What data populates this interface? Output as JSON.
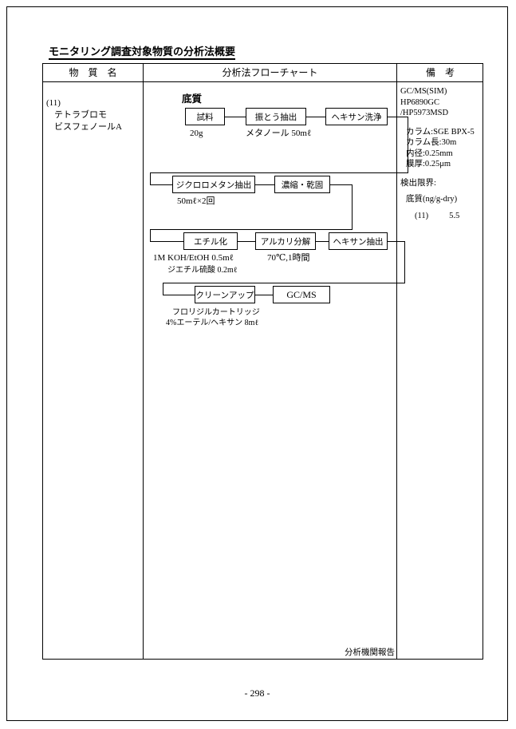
{
  "document": {
    "title": "モニタリング調査対象物質の分析法概要",
    "page_number": "- 298 -"
  },
  "table": {
    "headers": {
      "substance": "物　質　名",
      "flowchart": "分析法フローチャート",
      "remarks": "備　考"
    },
    "substance": {
      "number": "(11)",
      "name_line1": "テトラブロモ",
      "name_line2": "ビスフェノールA"
    },
    "remarks": {
      "instrument_line1": "GC/MS(SIM)",
      "instrument_line2": "HP6890GC",
      "instrument_line3": "/HP5973MSD",
      "column": "カラム:SGE BPX-5",
      "column_length": "カラム長:30m",
      "inner_diameter": "内径:0.25mm",
      "film_thickness": "膜厚:0.25μm",
      "detection_limit_label": "検出限界:",
      "detection_limit_matrix": "底質(ng/g-dry)",
      "detection_limit_id": "(11)",
      "detection_limit_value": "5.5"
    },
    "flowchart": {
      "matrix_label": "底質",
      "report_note": "分析機関報告",
      "nodes": {
        "sample": "試料",
        "shake_extraction": "振とう抽出",
        "hexane_wash": "ヘキサン洗浄",
        "dcm_extraction": "ジクロロメタン抽出",
        "concentrate_dry": "濃縮・乾固",
        "ethylation": "エチル化",
        "alkali_decomposition": "アルカリ分解",
        "hexane_extraction": "ヘキサン抽出",
        "cleanup": "クリーンアップ",
        "gcms": "GC/MS"
      },
      "notes": {
        "sample_amount": "20g",
        "shake_solvent": "メタノール 50mℓ",
        "dcm_volume": "50mℓ×2回",
        "ethylation_reagent1": "1M KOH/EtOH  0.5mℓ",
        "ethylation_reagent2": "ジエチル硫酸 0.2mℓ",
        "alkali_condition": "70℃,1時間",
        "cleanup_cartridge": "フロリジルカートリッジ",
        "cleanup_solvent": "4%エーテル/ヘキサン 8mℓ"
      }
    }
  }
}
